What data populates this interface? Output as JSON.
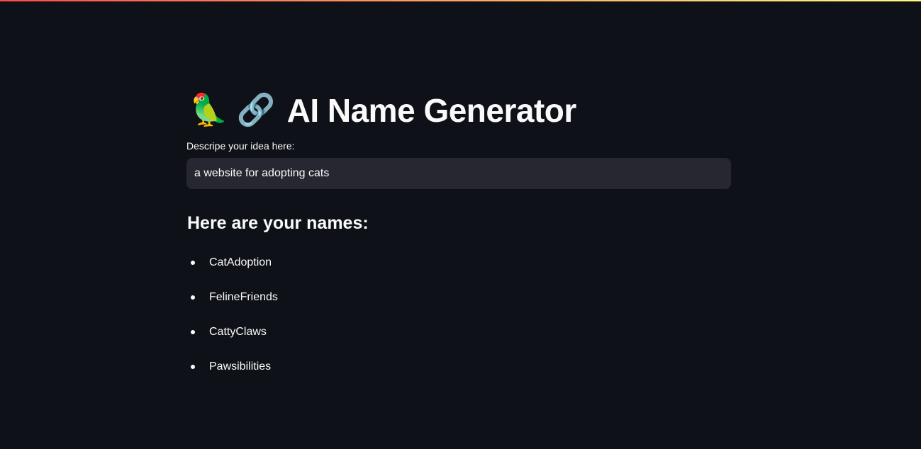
{
  "colors": {
    "background": "#0e1117",
    "input_background": "#262730",
    "text": "#fafafa",
    "top_bar_gradient": [
      "#ff4b4b",
      "#fffd80"
    ]
  },
  "header": {
    "icons": [
      "parrot-icon",
      "link-icon"
    ],
    "parrot_emoji": "🦜",
    "link_emoji": "🔗",
    "title": "AI Name Generator"
  },
  "input": {
    "label": "Descripe your idea here:",
    "value": "a website for adopting cats"
  },
  "results": {
    "heading": "Here are your names:",
    "names": [
      "CatAdoption",
      "FelineFriends",
      "CattyClaws",
      "Pawsibilities"
    ]
  }
}
